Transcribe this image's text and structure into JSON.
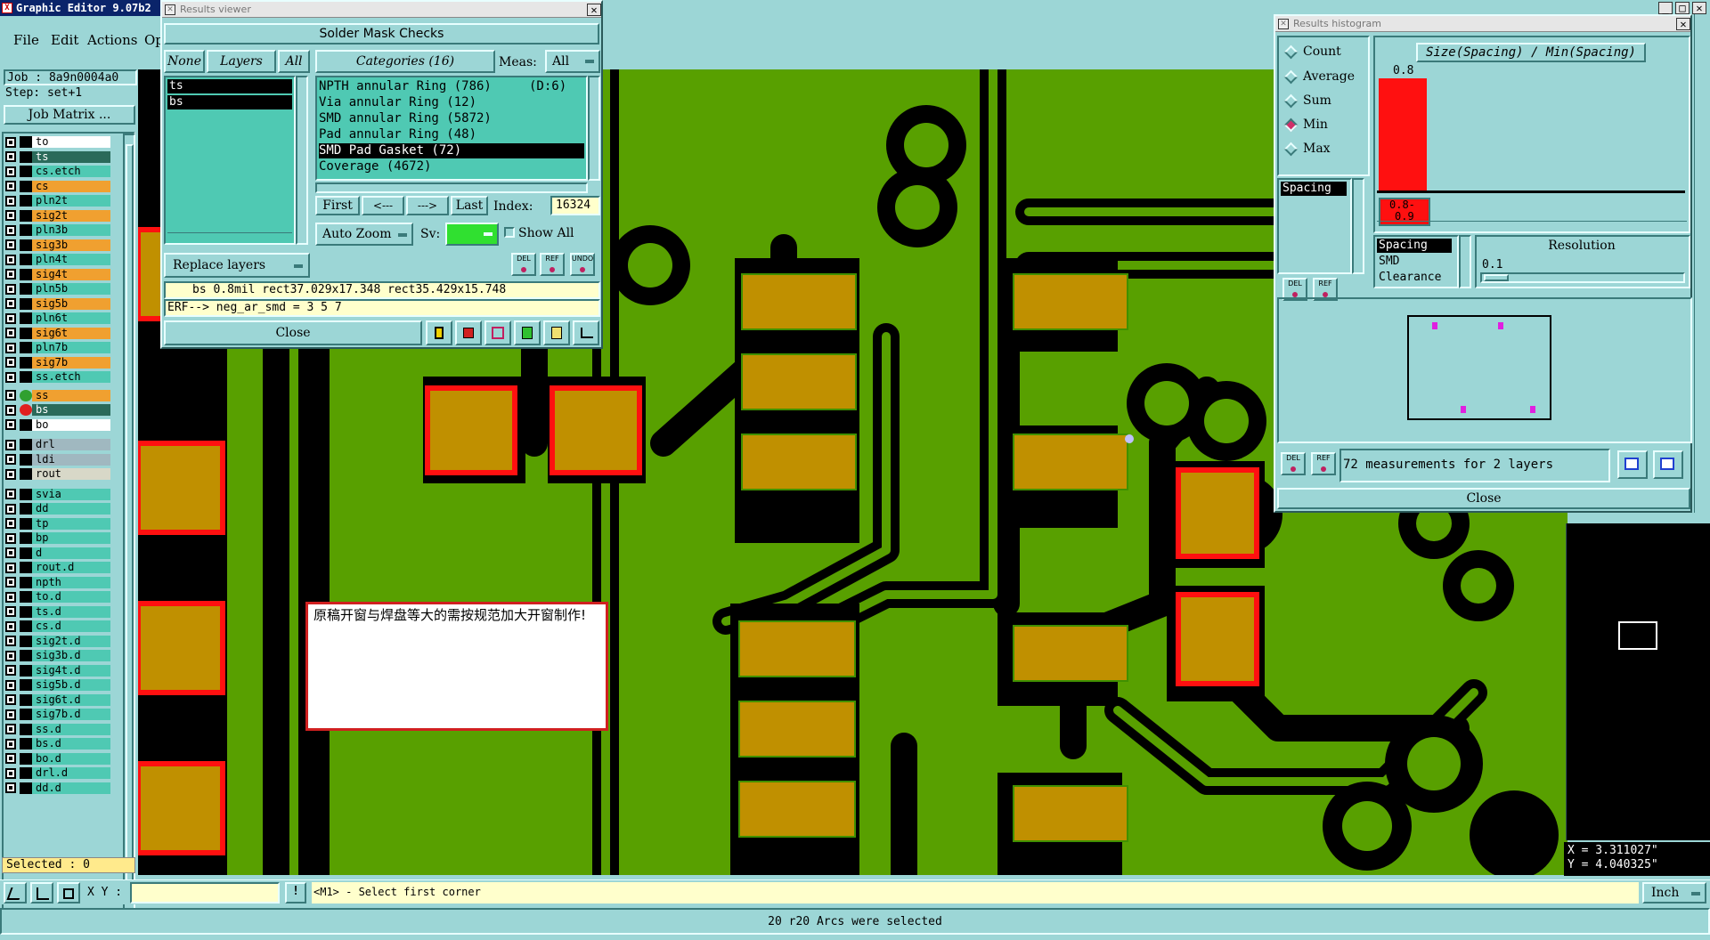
{
  "app": {
    "title": "Graphic Editor 9.07b2"
  },
  "menu": [
    "File",
    "Edit",
    "Actions",
    "Op"
  ],
  "job_panel": {
    "job": "Job : 8a9n0004a0",
    "step": "Step: set+1",
    "job_matrix_button": "Job Matrix ...",
    "selected": "Selected : 0"
  },
  "layers": [
    {
      "name": "to",
      "color": "#ffffff"
    },
    {
      "name": "ts",
      "color": "#2a6a5a"
    },
    {
      "name": "cs.etch",
      "color": "#4fc9b3"
    },
    {
      "name": "cs",
      "color": "#f0a030"
    },
    {
      "name": "pln2t",
      "color": "#4fc9b3"
    },
    {
      "name": "sig2t",
      "color": "#f0a030"
    },
    {
      "name": "pln3b",
      "color": "#4fc9b3"
    },
    {
      "name": "sig3b",
      "color": "#f0a030"
    },
    {
      "name": "pln4t",
      "color": "#4fc9b3"
    },
    {
      "name": "sig4t",
      "color": "#f0a030"
    },
    {
      "name": "pln5b",
      "color": "#4fc9b3"
    },
    {
      "name": "sig5b",
      "color": "#f0a030"
    },
    {
      "name": "pln6t",
      "color": "#4fc9b3"
    },
    {
      "name": "sig6t",
      "color": "#f0a030"
    },
    {
      "name": "pln7b",
      "color": "#4fc9b3"
    },
    {
      "name": "sig7b",
      "color": "#f0a030"
    },
    {
      "name": "ss.etch",
      "color": "#4fc9b3"
    },
    {
      "name": "ss",
      "color": "#f0a030"
    },
    {
      "name": "bs",
      "color": "#2a6a5a"
    },
    {
      "name": "bo",
      "color": "#ffffff"
    },
    {
      "name": "drl",
      "color": "#a0b8c0"
    },
    {
      "name": "ldi",
      "color": "#a0b8c0"
    },
    {
      "name": "rout",
      "color": "#d8d8c8"
    },
    {
      "name": "svia",
      "color": "#4fc9b3"
    },
    {
      "name": "dd",
      "color": "#4fc9b3"
    },
    {
      "name": "tp",
      "color": "#4fc9b3"
    },
    {
      "name": "bp",
      "color": "#4fc9b3"
    },
    {
      "name": "d",
      "color": "#4fc9b3"
    },
    {
      "name": "rout.d",
      "color": "#4fc9b3"
    },
    {
      "name": "npth",
      "color": "#4fc9b3"
    },
    {
      "name": "to.d",
      "color": "#4fc9b3"
    },
    {
      "name": "ts.d",
      "color": "#4fc9b3"
    },
    {
      "name": "cs.d",
      "color": "#4fc9b3"
    },
    {
      "name": "sig2t.d",
      "color": "#4fc9b3"
    },
    {
      "name": "sig3b.d",
      "color": "#4fc9b3"
    },
    {
      "name": "sig4t.d",
      "color": "#4fc9b3"
    },
    {
      "name": "sig5b.d",
      "color": "#4fc9b3"
    },
    {
      "name": "sig6t.d",
      "color": "#4fc9b3"
    },
    {
      "name": "sig7b.d",
      "color": "#4fc9b3"
    },
    {
      "name": "ss.d",
      "color": "#4fc9b3"
    },
    {
      "name": "bs.d",
      "color": "#4fc9b3"
    },
    {
      "name": "bo.d",
      "color": "#4fc9b3"
    },
    {
      "name": "drl.d",
      "color": "#4fc9b3"
    },
    {
      "name": "dd.d",
      "color": "#4fc9b3"
    }
  ],
  "results_viewer": {
    "window_title": "Results viewer",
    "header": "Solder Mask Checks",
    "none_btn": "None",
    "layers_btn": "Layers",
    "all_btn": "All",
    "categories_btn": "Categories (16)",
    "meas_label": "Meas:",
    "meas_value": "All",
    "layer_list": [
      "ts",
      "bs"
    ],
    "categories": [
      {
        "label": "NPTH annular Ring (786)",
        "extra": "(D:6)"
      },
      {
        "label": "Via annular Ring (12)",
        "extra": ""
      },
      {
        "label": "SMD annular Ring (5872)",
        "extra": ""
      },
      {
        "label": "Pad annular Ring (48)",
        "extra": ""
      },
      {
        "label": "SMD Pad Gasket (72)",
        "extra": ""
      },
      {
        "label": "Coverage (4672)",
        "extra": ""
      }
    ],
    "first_btn": "First",
    "prev_btn": "<---",
    "next_btn": "--->",
    "last_btn": "Last",
    "index_label": "Index:",
    "index_value": "16324",
    "auto_zoom": "Auto Zoom",
    "sv_label": "Sv:",
    "show_all": "Show All",
    "replace_layers": "Replace layers",
    "del": "DEL",
    "ref": "REF",
    "undo": "UNDO",
    "info_line": "bs 0.8mil   rect37.029x17.348   rect35.429x15.748",
    "erf_line": "ERF--> neg_ar_smd = 3 5 7",
    "close_btn": "Close"
  },
  "histogram": {
    "window_title": "Results histogram",
    "radios": [
      "Count",
      "Average",
      "Sum",
      "Min",
      "Max"
    ],
    "selected_radio": "Min",
    "header": "Size(Spacing) / Min(Spacing)",
    "bar_value_label": "0.8",
    "range_label_1": "0.8-",
    "range_label_2": "0.9",
    "left_list": [
      "Spacing"
    ],
    "measure_list": [
      "Spacing",
      "SMD",
      "Clearance"
    ],
    "resolution_label": "Resolution",
    "resolution_value": "0.1",
    "del": "DEL",
    "ref": "REF",
    "summary": "72 measurements for 2 layers",
    "close_btn": "Close"
  },
  "note": "原稿开窗与焊盘等大的需按规范加大开窗制作!",
  "bottom": {
    "xy_label": "X Y :",
    "xy_value": "",
    "prompt": "<M1> - Select first corner",
    "units": "Inch",
    "status": "20 r20 Arcs were selected"
  },
  "coords": {
    "x": "X = 3.311027\"",
    "y": "Y = 4.040325\""
  },
  "colors": {
    "board": "#58a000",
    "pad": "#c09000",
    "mask_error": "#ff1010",
    "ui_bg": "#9cd6d6",
    "teal_field": "#4fc9b3"
  }
}
